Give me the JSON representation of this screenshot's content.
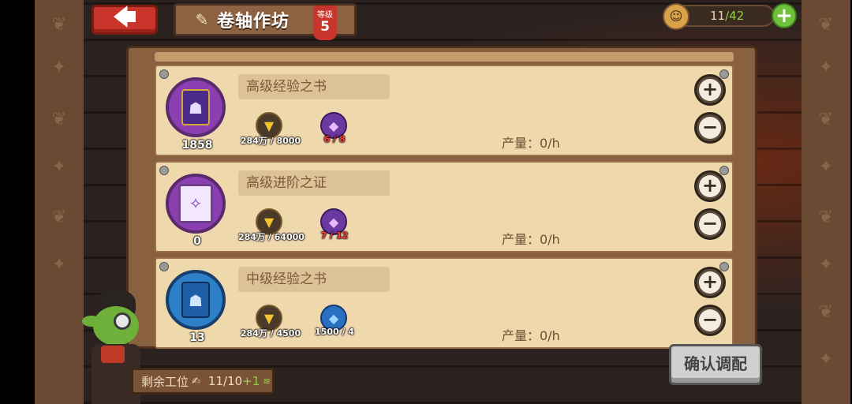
{
  "header": {
    "back_icon": "arrow-left-icon",
    "title": "卷轴作坊",
    "title_icon": "scroll-feather-icon",
    "level_label": "等级",
    "level_value": "5"
  },
  "workers_top": {
    "icon": "goblin-head-icon",
    "current": "11",
    "max": "/42",
    "add_icon": "plus-icon"
  },
  "rows": [
    {
      "name": "高级经验之书",
      "count": "1858",
      "gold_cost": "284万 / 8000",
      "crystal_cost": "6 / 8",
      "crystal_insufficient": true,
      "output_label": "产量：",
      "output_value": "0/h",
      "color": "#8b3fb1"
    },
    {
      "name": "高级进阶之证",
      "count": "0",
      "gold_cost": "284万 / 64000",
      "crystal_cost": "7 / 12",
      "crystal_insufficient": true,
      "output_label": "产量：",
      "output_value": "0/h",
      "color": "#8b3fb1"
    },
    {
      "name": "中级经验之书",
      "count": "13",
      "gold_cost": "284万 / 4500",
      "crystal_cost": "1500 / 4",
      "crystal_insufficient": false,
      "output_label": "产量：",
      "output_value": "0/h",
      "color": "#2d7fc8"
    }
  ],
  "remaining": {
    "label": "剩余工位",
    "value": "11/10",
    "bonus": "+1"
  },
  "confirm_label": "确认调配",
  "colors": {
    "accent_red": "#c9342b",
    "accent_green": "#6fc03a",
    "parchment": "#f0d8ad",
    "wood": "#8a6140"
  }
}
